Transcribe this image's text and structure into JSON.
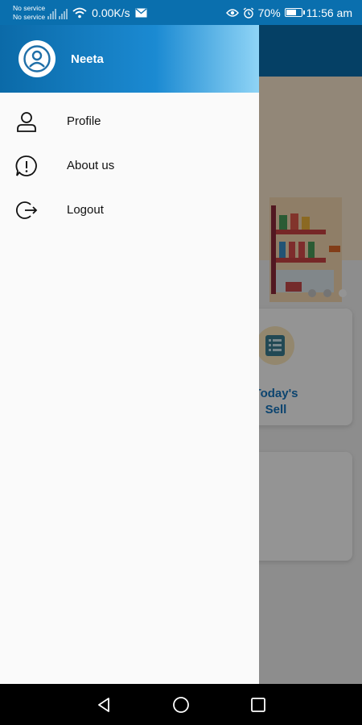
{
  "status_bar": {
    "carrier_1": "No service",
    "carrier_2": "No service",
    "net_speed": "0.00K/s",
    "battery": "70%",
    "battery_level": 0.7,
    "time": "11:56 am"
  },
  "drawer": {
    "user_name": "Neeta",
    "items": [
      {
        "label": "Profile",
        "icon": "person-icon"
      },
      {
        "label": "About us",
        "icon": "info-alert-icon"
      },
      {
        "label": "Logout",
        "icon": "logout-icon"
      }
    ]
  },
  "background": {
    "card_label_1": "Today's",
    "card_label_2": "Sell",
    "carousel_active_index": 2
  },
  "colors": {
    "primary": "#0a6fae",
    "accent_text": "#1576c0"
  }
}
